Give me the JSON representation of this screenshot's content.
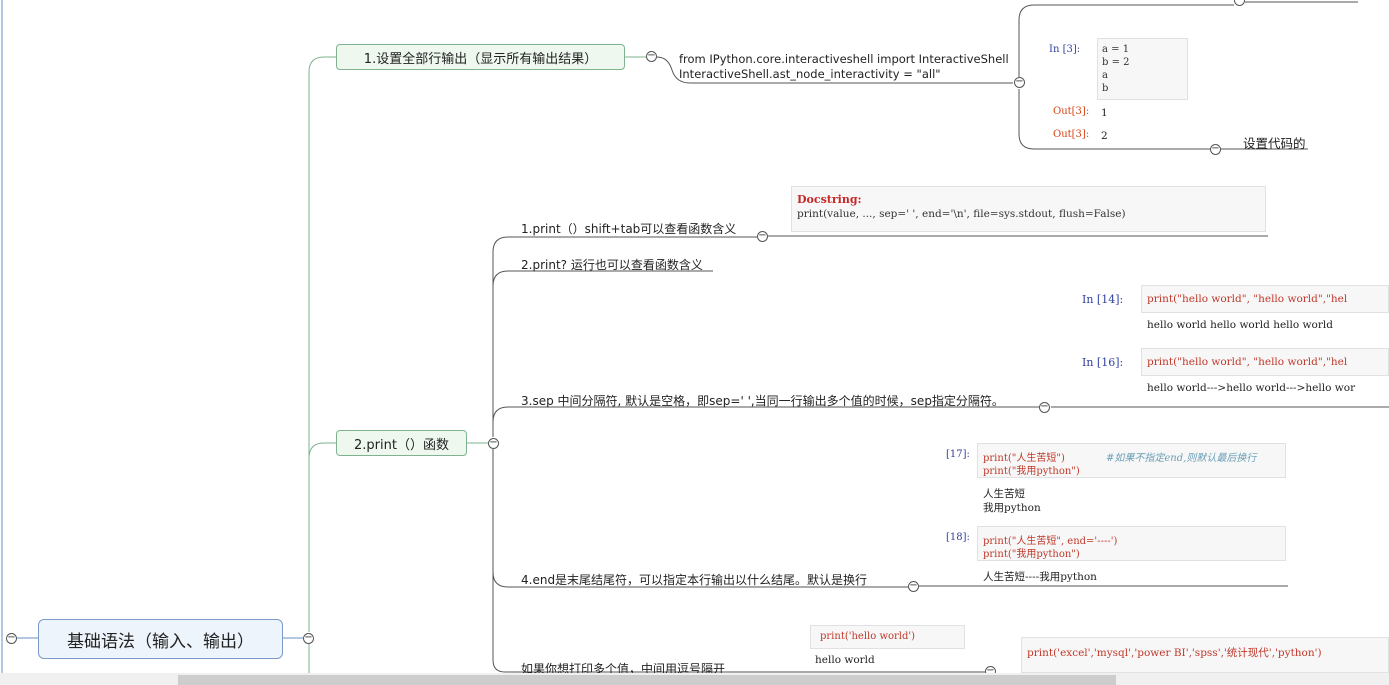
{
  "root": {
    "label": "基础语法（输入、输出）"
  },
  "branch1": {
    "label": "1.设置全部行输出（显示所有输出结果）",
    "code_line1": "from IPython.core.interactiveshell import InteractiveShell",
    "code_line2": "InteractiveShell.ast_node_interactivity = \"all\"",
    "example": {
      "prompt_in": "In  [3]:",
      "lines": [
        "a = 1",
        "b = 2",
        "a",
        "b"
      ],
      "out1_prompt": "Out[3]:",
      "out1_value": "1",
      "out2_prompt": "Out[3]:",
      "out2_value": "2"
    },
    "note": "设置代码的"
  },
  "branch2": {
    "label": "2.print（）函数",
    "items": [
      {
        "text": "1.print（）shift+tab可以查看函数含义"
      },
      {
        "text": "2.print? 运行也可以查看函数含义"
      },
      {
        "text": "3.sep 中间分隔符, 默认是空格，即sep=' ',当同一行输出多个值的时候，sep指定分隔符。"
      },
      {
        "text": "4.end是末尾结尾符，可以指定本行输出以什么结尾。默认是换行"
      },
      {
        "text": "如果你想打印多个值，中间用逗号隔开"
      }
    ],
    "docstring": {
      "title": "Docstring:",
      "signature": "print(value, ..., sep=' ', end='\\n', file=sys.stdout, flush=False)"
    },
    "sep_examples": [
      {
        "prompt": "In  [14]:",
        "code": "print(\"hello world\", \"hello world\",\"hel",
        "output": "hello world hello world hello world"
      },
      {
        "prompt": "In  [16]:",
        "code": "print(\"hello world\", \"hello world\",\"hel",
        "output": "hello world--->hello world--->hello wor"
      }
    ],
    "end_examples": [
      {
        "prompt": "[17]:",
        "line1": "print(\"人生苦短\")",
        "comment": "#如果不指定end,则默认最后换行",
        "line2": "print(\"我用python\")",
        "out1": "人生苦短",
        "out2": "我用python"
      },
      {
        "prompt": "[18]:",
        "line1": "print(\"人生苦短\", end='----')",
        "line2": "print(\"我用python\")",
        "out1": "人生苦短----我用python"
      }
    ],
    "multi_examples": {
      "code1": "print('hello world')",
      "out1": "hello world",
      "code2": "print('excel','mysql','power BI','spss','统计现代','python')"
    }
  }
}
